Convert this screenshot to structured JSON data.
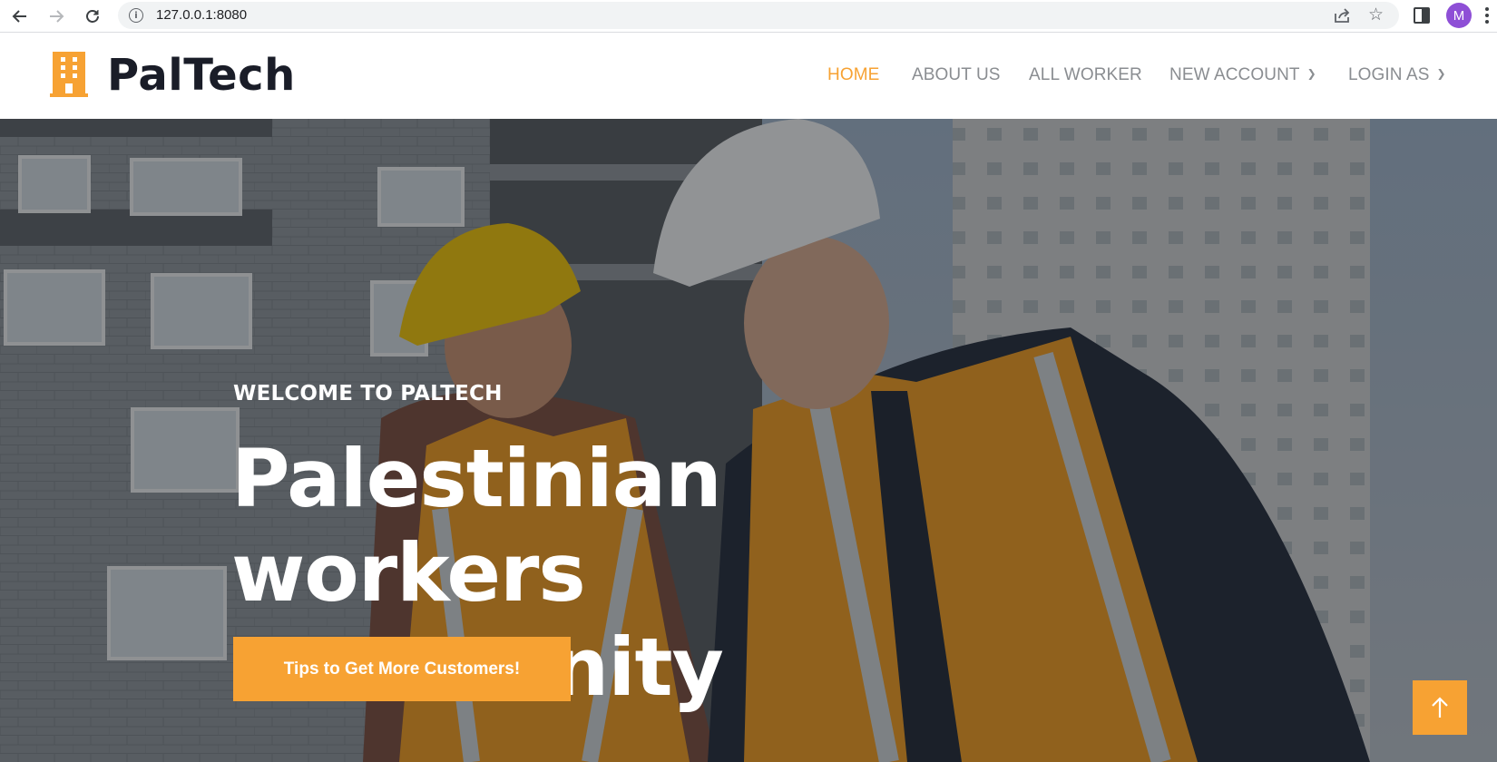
{
  "browser": {
    "url": "127.0.0.1:8080",
    "profile_initial": "M",
    "back_icon": "arrow-left-icon",
    "forward_icon": "arrow-right-icon",
    "reload_icon": "reload-icon",
    "info_icon": "info-icon",
    "share_icon": "share-icon",
    "bookmark_icon": "star-icon",
    "sidepanel_icon": "side-panel-icon",
    "menu_icon": "kebab-menu-icon"
  },
  "header": {
    "logo_text": "PalTech",
    "logo_icon": "building-icon",
    "nav": [
      {
        "label": "HOME",
        "active": true,
        "dropdown": false
      },
      {
        "label": "ABOUT US",
        "active": false,
        "dropdown": false
      },
      {
        "label": "ALL WORKER",
        "active": false,
        "dropdown": false
      },
      {
        "label": "NEW ACCOUNT",
        "active": false,
        "dropdown": true
      },
      {
        "label": "LOGIN AS",
        "active": false,
        "dropdown": true
      }
    ]
  },
  "hero": {
    "eyebrow": "WELCOME TO PALTECH",
    "title_line1": "Palestinian workers",
    "title_line2": "community",
    "cta_label": "Tips to Get More Customers!",
    "scroll_top_icon": "arrow-up-icon"
  },
  "colors": {
    "accent": "#f7a233",
    "logo_text": "#1a1d28",
    "nav_text": "#8a8d91",
    "hero_text": "#ffffff"
  }
}
